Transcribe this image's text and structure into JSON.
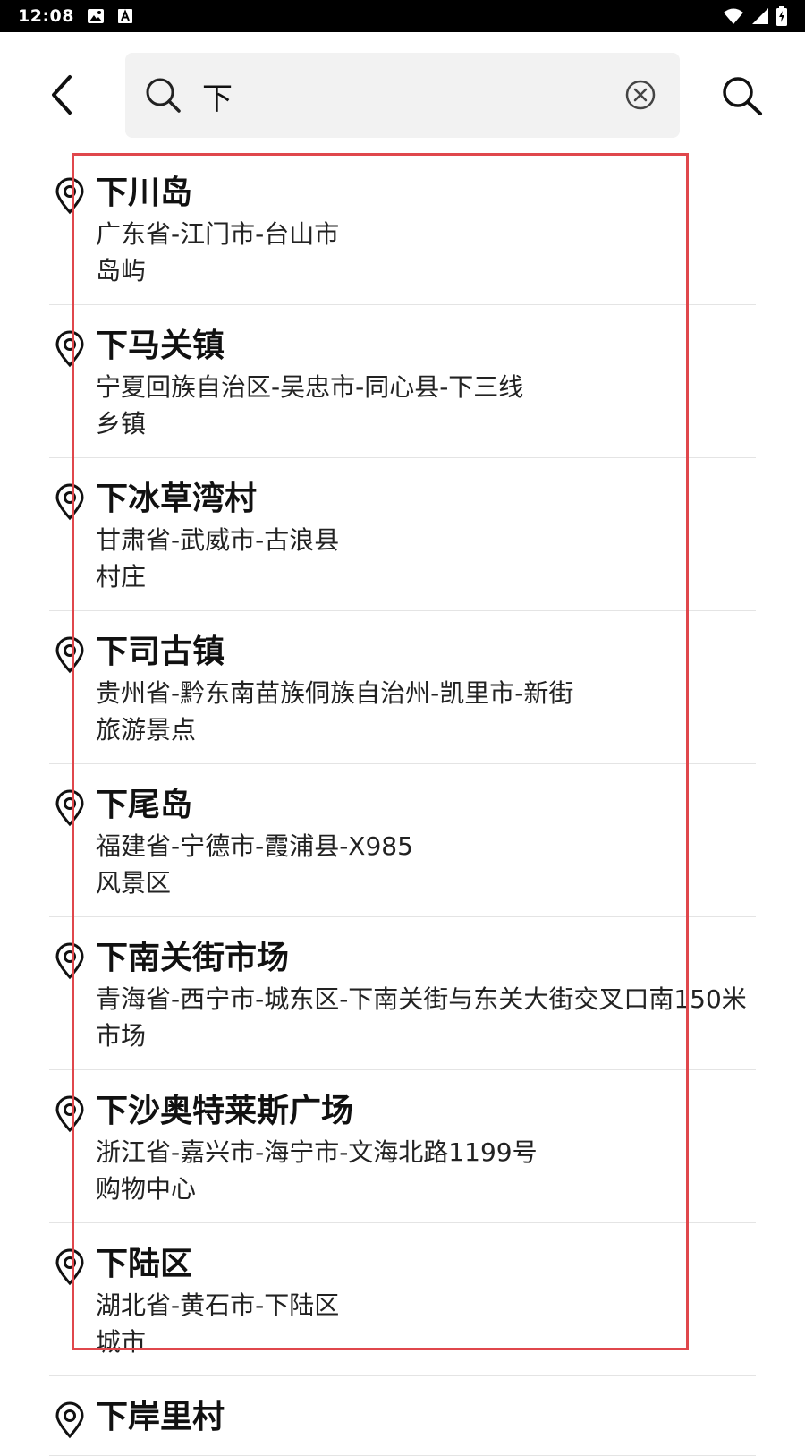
{
  "status_bar": {
    "time": "12:08"
  },
  "search": {
    "query": "下"
  },
  "results": [
    {
      "name": "下川岛",
      "address": "广东省-江门市-台山市",
      "category": "岛屿"
    },
    {
      "name": "下马关镇",
      "address": "宁夏回族自治区-吴忠市-同心县-下三线",
      "category": "乡镇"
    },
    {
      "name": "下冰草湾村",
      "address": "甘肃省-武威市-古浪县",
      "category": "村庄"
    },
    {
      "name": "下司古镇",
      "address": "贵州省-黔东南苗族侗族自治州-凯里市-新街",
      "category": "旅游景点"
    },
    {
      "name": "下尾岛",
      "address": "福建省-宁德市-霞浦县-X985",
      "category": "风景区"
    },
    {
      "name": "下南关街市场",
      "address": "青海省-西宁市-城东区-下南关街与东关大街交叉口南150米",
      "category": "市场"
    },
    {
      "name": "下沙奥特莱斯广场",
      "address": "浙江省-嘉兴市-海宁市-文海北路1199号",
      "category": "购物中心"
    },
    {
      "name": "下陆区",
      "address": "湖北省-黄石市-下陆区",
      "category": "城市"
    },
    {
      "name": "下岸里村",
      "address": "",
      "category": ""
    }
  ],
  "colors": {
    "highlight_border": "#e0474c",
    "search_bg": "#f2f2f2",
    "divider": "#e4e4e4"
  },
  "icons": {
    "back": "chevron-left-icon",
    "search": "search-icon",
    "clear": "clear-circle-icon",
    "result": "location-pin-icon"
  }
}
